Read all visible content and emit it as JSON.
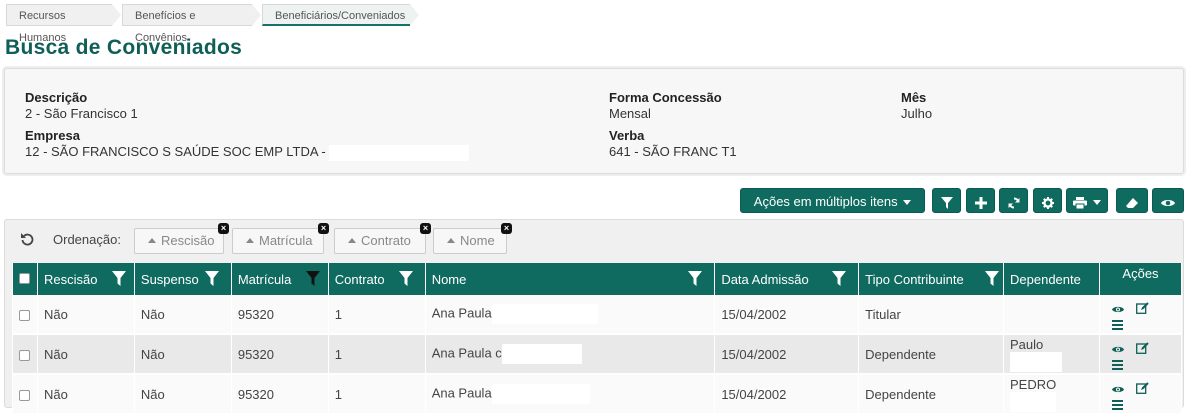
{
  "breadcrumb": [
    "Recursos Humanos",
    "Benefícios e Convênios",
    "Beneficiários/Conveniados"
  ],
  "page_title": "Busca de Conveniados",
  "info": {
    "descricao_label": "Descrição",
    "descricao_value": "2 - São Francisco 1",
    "empresa_label": "Empresa",
    "empresa_value": "12 - SÃO FRANCISCO S SAÚDE SOC EMP LTDA -",
    "forma_label": "Forma Concessão",
    "forma_value": "Mensal",
    "verba_label": "Verba",
    "verba_value": "641 - SÃO FRANC T1",
    "mes_label": "Mês",
    "mes_value": "Julho"
  },
  "toolbar": {
    "multi_actions_label": "Ações em múltiplos itens",
    "icons": [
      "filter-icon",
      "plus-icon",
      "refresh-icon",
      "gear-icon",
      "print-icon",
      "eraser-icon",
      "eye-icon"
    ]
  },
  "sort": {
    "label": "Ordenação:",
    "chips": [
      "Rescisão",
      "Matrícula",
      "Contrato",
      "Nome"
    ]
  },
  "table": {
    "headers": [
      "Rescisão",
      "Suspenso",
      "Matrícula",
      "Contrato",
      "Nome",
      "Data Admissão",
      "Tipo Contribuinte",
      "Dependente",
      "Ações"
    ],
    "rows": [
      {
        "rescisao": "Não",
        "suspenso": "Não",
        "matricula": "95320",
        "contrato": "1",
        "nome": "Ana Paula",
        "data": "15/04/2002",
        "tipo": "Titular",
        "dependente": ""
      },
      {
        "rescisao": "Não",
        "suspenso": "Não",
        "matricula": "95320",
        "contrato": "1",
        "nome": "Ana Paula c",
        "data": "15/04/2002",
        "tipo": "Dependente",
        "dependente": "Paulo"
      },
      {
        "rescisao": "Não",
        "suspenso": "Não",
        "matricula": "95320",
        "contrato": "1",
        "nome": "Ana Paula",
        "data": "15/04/2002",
        "tipo": "Dependente",
        "dependente": "PEDRO"
      }
    ]
  },
  "colors": {
    "primary": "#0f6a5f",
    "title": "#0f5e57"
  }
}
